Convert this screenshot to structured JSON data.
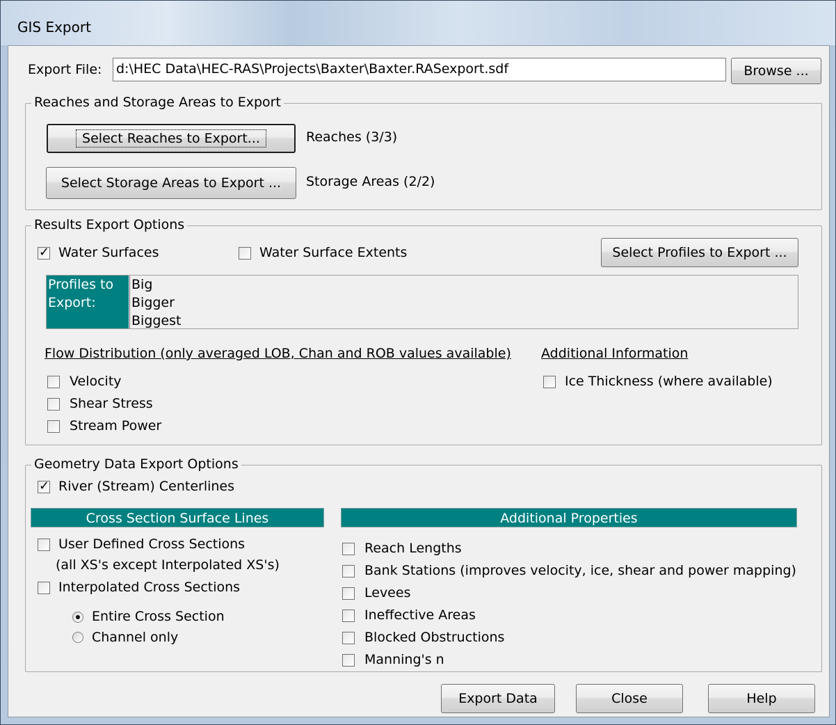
{
  "window": {
    "title": "GIS Export"
  },
  "export_file": {
    "label": "Export File:",
    "value": "d:\\HEC Data\\HEC-RAS\\Projects\\Baxter\\Baxter.RASexport.sdf",
    "browse_label": "Browse ..."
  },
  "reaches_group": {
    "title": "Reaches and Storage Areas to Export",
    "select_reaches_label": "Select Reaches to Export...",
    "reaches_status": "Reaches (3/3)",
    "select_storage_label": "Select Storage Areas to Export ...",
    "storage_status": "Storage Areas (2/2)"
  },
  "results_group": {
    "title": "Results Export Options",
    "water_surfaces": {
      "label": "Water Surfaces",
      "checked": true
    },
    "water_surface_extents": {
      "label": "Water Surface Extents",
      "checked": false
    },
    "select_profiles_label": "Select Profiles to Export ...",
    "profiles_header_line1": "Profiles to",
    "profiles_header_line2": "Export:",
    "profiles": [
      "Big",
      "Bigger",
      "Biggest"
    ],
    "flow_distribution_title": "Flow Distribution (only averaged LOB, Chan and ROB values available)",
    "velocity": {
      "label": "Velocity",
      "checked": false
    },
    "shear_stress": {
      "label": "Shear Stress",
      "checked": false
    },
    "stream_power": {
      "label": "Stream Power",
      "checked": false
    },
    "additional_info_title": "Additional Information",
    "ice_thickness": {
      "label": "Ice Thickness (where available)",
      "checked": false
    }
  },
  "geometry_group": {
    "title": "Geometry Data Export Options",
    "centerlines": {
      "label": "River (Stream) Centerlines",
      "checked": true
    },
    "xs_banner": "Cross Section Surface Lines",
    "user_defined": {
      "label": "User Defined Cross Sections",
      "checked": false
    },
    "user_defined_note": "(all XS's except Interpolated XS's)",
    "interpolated": {
      "label": "Interpolated Cross Sections",
      "checked": false
    },
    "entire_xs": {
      "label": "Entire Cross Section",
      "selected": true
    },
    "channel_only": {
      "label": "Channel only",
      "selected": false
    },
    "props_banner": "Additional Properties",
    "reach_lengths": {
      "label": "Reach Lengths",
      "checked": false
    },
    "bank_stations": {
      "label": "Bank Stations (improves velocity, ice, shear and power mapping)",
      "checked": false
    },
    "levees": {
      "label": "Levees",
      "checked": false
    },
    "ineffective": {
      "label": "Ineffective Areas",
      "checked": false
    },
    "blocked": {
      "label": "Blocked Obstructions",
      "checked": false
    },
    "mannings": {
      "label": "Manning's n",
      "checked": false
    }
  },
  "footer": {
    "export_label": "Export Data",
    "close_label": "Close",
    "help_label": "Help"
  },
  "colors": {
    "teal": "#008080",
    "dialog_bg": "#f0f0f0"
  }
}
